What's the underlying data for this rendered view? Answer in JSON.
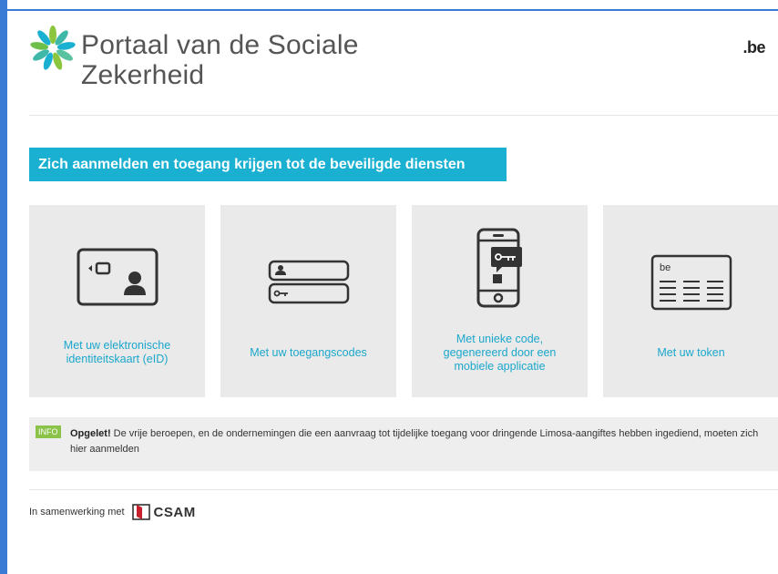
{
  "header": {
    "brand_title_line1": "Portaal van de Sociale",
    "brand_title_line2": "Zekerheid",
    "logo_icon": "flower-logo-icon",
    "lang_link": ".be"
  },
  "banner": {
    "title": "Zich aanmelden en toegang krijgen tot de beveiligde diensten"
  },
  "cards": [
    {
      "icon": "eid-card-icon",
      "label_line1": "Met uw elektronische",
      "label_line2": "identiteitskaart (eID)",
      "label_line3": ""
    },
    {
      "icon": "login-codes-icon",
      "label_line1": "Met uw toegangscodes",
      "label_line2": "",
      "label_line3": ""
    },
    {
      "icon": "mobile-app-icon",
      "label_line1": "Met unieke code,",
      "label_line2": "gegenereerd door een",
      "label_line3": "mobiele applicatie"
    },
    {
      "icon": "token-card-icon",
      "label_line1": "Met uw token",
      "label_line2": "",
      "label_line3": ""
    }
  ],
  "token_icon_text": "be",
  "info": {
    "badge": "INFO",
    "strong": "Opgelet!",
    "text": " De vrije beroepen, en de ondernemingen die een aanvraag tot tijdelijke toegang voor dringende Limosa-aangiftes hebben ingediend, moeten zich hier aanmelden"
  },
  "footer": {
    "text": "In samenwerking met",
    "partner": "CSAM",
    "partner_icon": "csam-logo-icon"
  },
  "colors": {
    "accent": "#1ab0d1",
    "link": "#1ba7cc",
    "info_badge": "#8bc34a",
    "card_bg": "#eaeaea"
  }
}
